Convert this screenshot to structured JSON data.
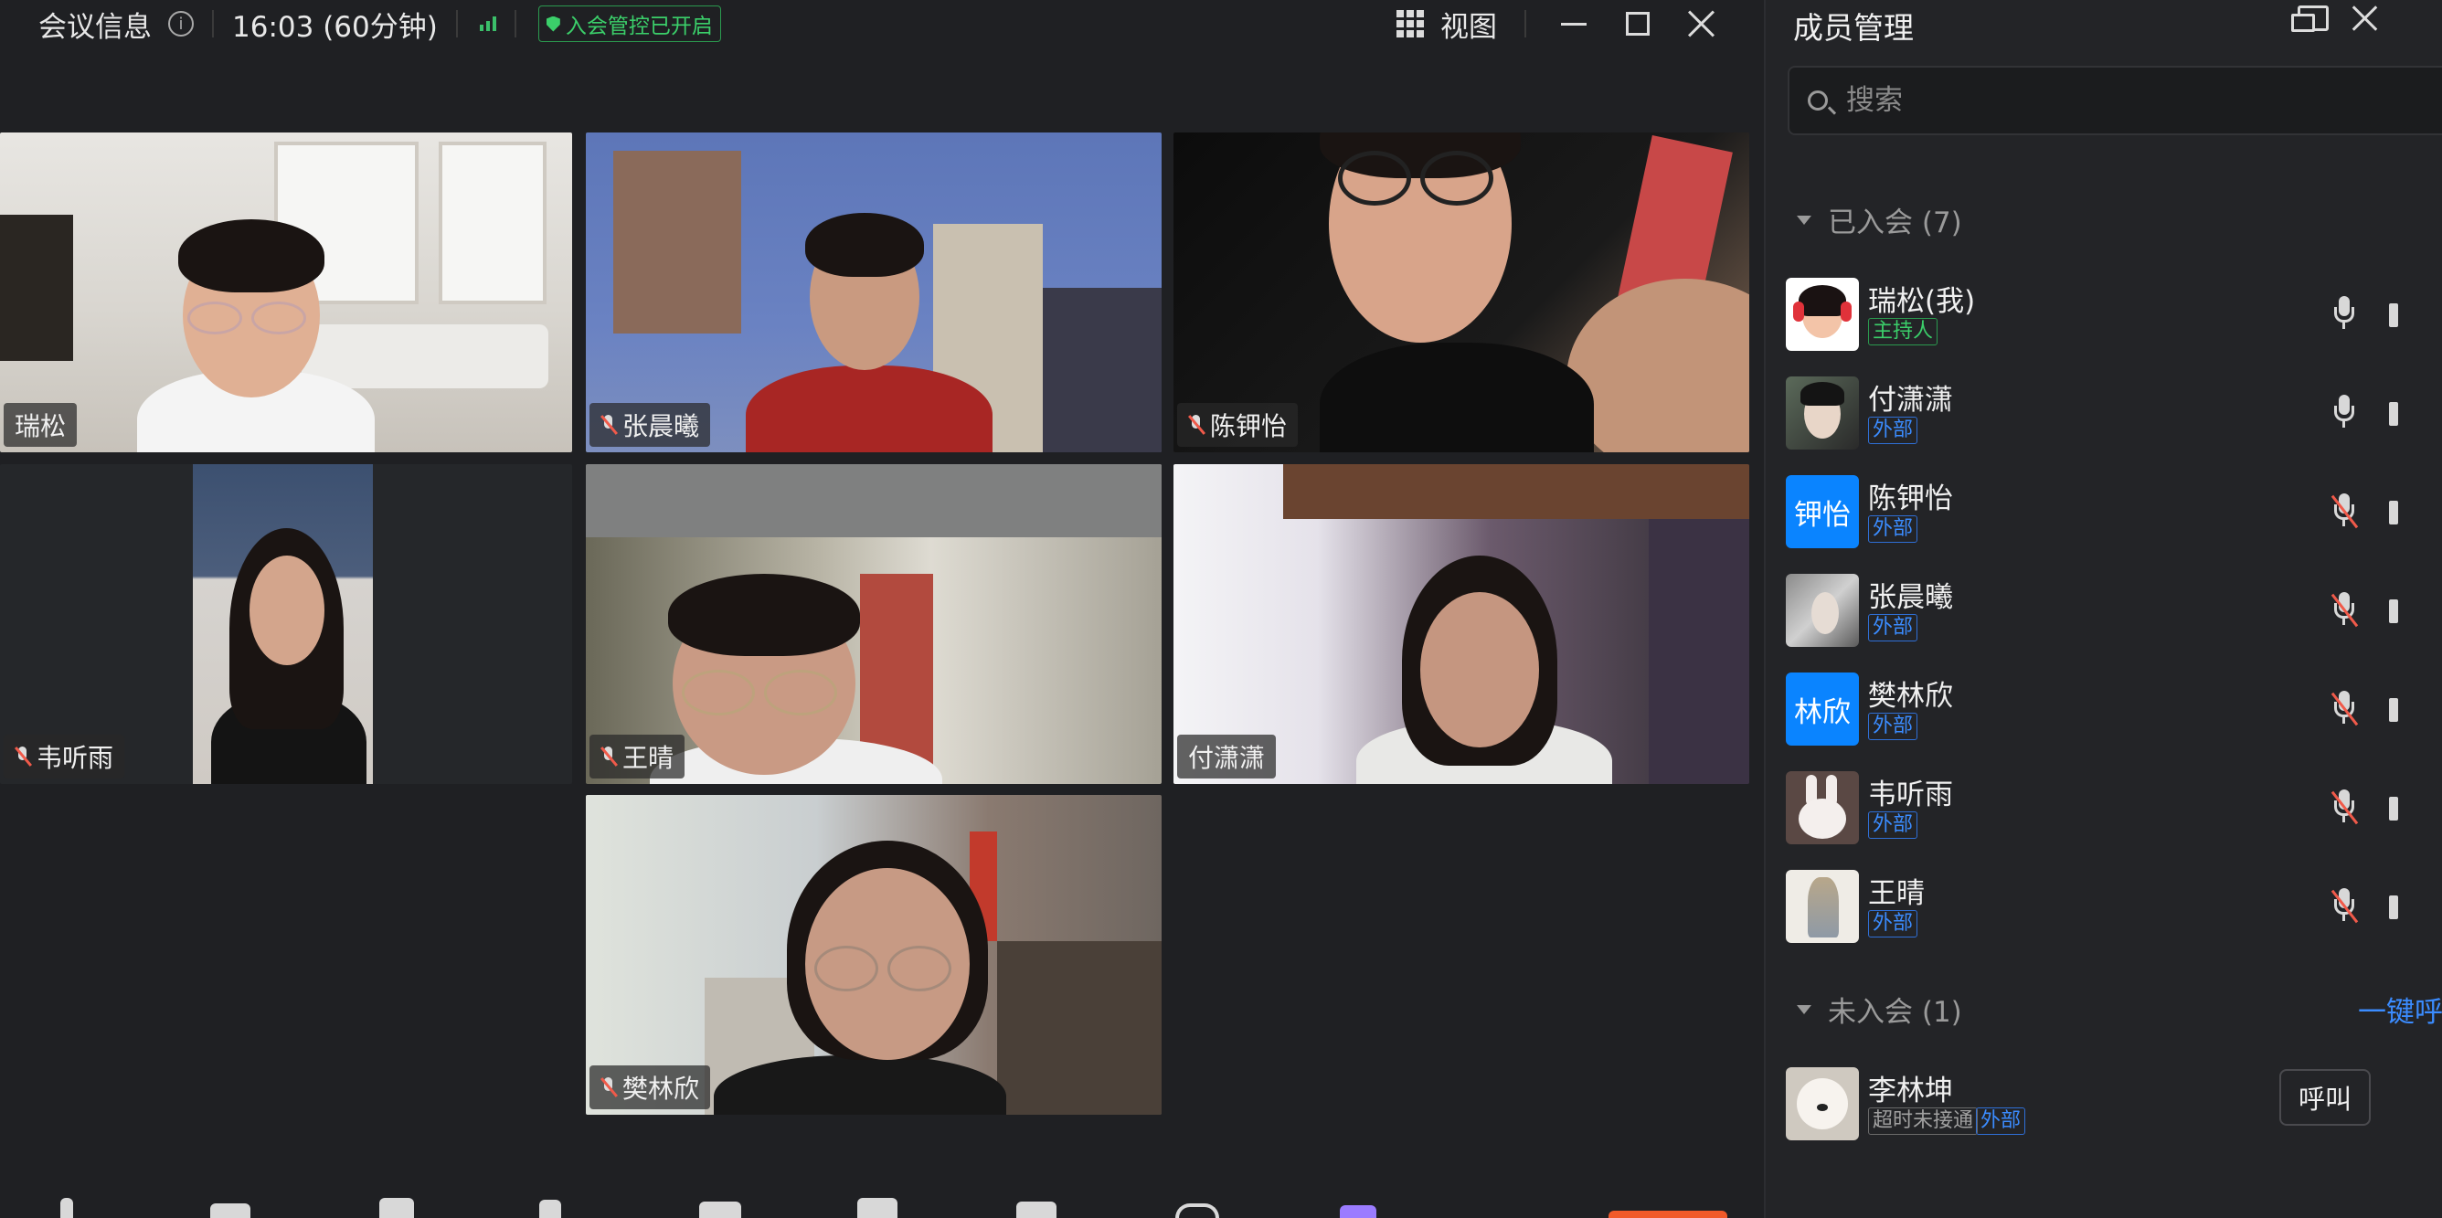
{
  "topbar": {
    "title": "会议信息",
    "time": "16:03 (60分钟)",
    "security_badge": "入会管控已开启",
    "view_label": "视图"
  },
  "tiles": [
    {
      "name": "瑞松",
      "muted": false
    },
    {
      "name": "张晨曦",
      "muted": true
    },
    {
      "name": "陈钾怡",
      "muted": true
    },
    {
      "name": "韦听雨",
      "muted": true
    },
    {
      "name": "王晴",
      "muted": true
    },
    {
      "name": "付潇潇",
      "muted": false
    },
    {
      "name": "樊林欣",
      "muted": true
    }
  ],
  "panel": {
    "title": "成员管理",
    "search_placeholder": "搜索",
    "joined_header": "已入会 (7)",
    "not_joined_header": "未入会 (1)",
    "call_all": "一键呼",
    "members": [
      {
        "name": "瑞松(我)",
        "tag": "主持人",
        "tag_type": "host",
        "mic": "on"
      },
      {
        "name": "付潇潇",
        "tag": "外部",
        "tag_type": "ext",
        "mic": "on"
      },
      {
        "name": "陈钾怡",
        "tag": "外部",
        "tag_type": "ext",
        "mic": "off",
        "avatar_text": "钾怡"
      },
      {
        "name": "张晨曦",
        "tag": "外部",
        "tag_type": "ext",
        "mic": "off"
      },
      {
        "name": "樊林欣",
        "tag": "外部",
        "tag_type": "ext",
        "mic": "off",
        "avatar_text": "林欣"
      },
      {
        "name": "韦听雨",
        "tag": "外部",
        "tag_type": "ext",
        "mic": "off"
      },
      {
        "name": "王晴",
        "tag": "外部",
        "tag_type": "ext",
        "mic": "off"
      }
    ],
    "pending": {
      "name": "李林坤",
      "tag1": "超时未接通",
      "tag2": "外部",
      "call_label": "呼叫"
    }
  },
  "colors": {
    "accent_blue": "#0a84ff",
    "host_green": "#3bcf6a",
    "muted_red": "#f05a4a"
  }
}
